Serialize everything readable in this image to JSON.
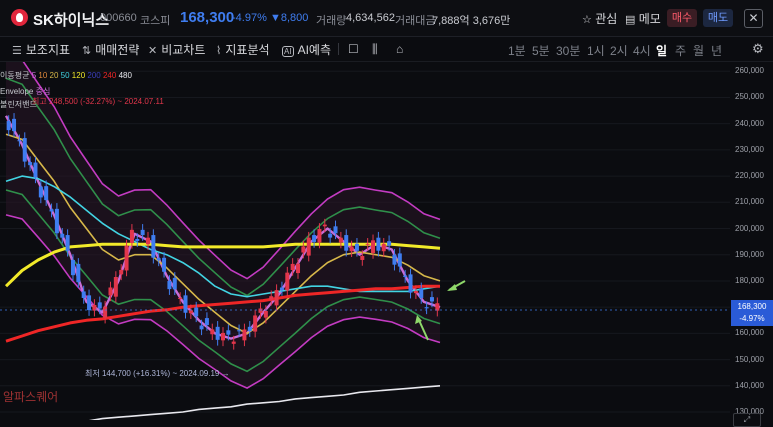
{
  "header": {
    "name": "SK하이닉스",
    "code": "000660",
    "market": "코스피",
    "price": "168,300",
    "change_pct": "-4.97%",
    "change_abs": "▼8,800",
    "volume_label": "거래량",
    "volume": "4,634,562",
    "amount_label": "거래대금",
    "amount": "7,888억 3,676만",
    "interest": "관심",
    "memo": "메모",
    "buy": "매수",
    "sell": "매도"
  },
  "toolbar": {
    "items": [
      "보조지표",
      "매매전략",
      "비교차트",
      "지표분석",
      "AI예측"
    ],
    "periods": [
      "1분",
      "5분",
      "30분",
      "1시",
      "2시",
      "4시",
      "일",
      "주",
      "월",
      "년"
    ],
    "active_period": "일"
  },
  "legend": {
    "ma_title": "이동평균",
    "ma_periods": [
      "5",
      "10",
      "20",
      "50",
      "120",
      "200",
      "240",
      "480"
    ],
    "envelope": "Envelope",
    "envelope_sub": "중심",
    "bollinger": "볼린저밴드",
    "bollinger_sub": "최고 248,500 (-32.27%) ~ 2024.07.11"
  },
  "annotations": {
    "min": "최저 144,700 (+16.31%) ~ 2024.09.19 →"
  },
  "axis": {
    "labels": [
      "260,000",
      "250,000",
      "240,000",
      "230,000",
      "220,000",
      "210,000",
      "200,000",
      "190,000",
      "180,000",
      "170,000",
      "160,000",
      "150,000",
      "140,000",
      "130,000"
    ]
  },
  "current": {
    "price": "168,300",
    "pct": "-4.97%"
  },
  "watermark": "알파스퀘어",
  "colors": {
    "up": "#e2364b",
    "down": "#3f7df0",
    "accent": "#3f7df0"
  },
  "chart_data": {
    "type": "line",
    "title": "",
    "ylim": [
      130000,
      262000
    ],
    "y_ticks": [
      260000,
      250000,
      240000,
      230000,
      220000,
      210000,
      200000,
      190000,
      180000,
      170000,
      160000,
      150000,
      140000,
      130000
    ],
    "series": [
      {
        "name": "5",
        "color": "#c86dd7",
        "values": [
          243000,
          232000,
          218000,
          205000,
          190000,
          172000,
          168000,
          180000,
          198000,
          195000,
          182000,
          172000,
          165000,
          160000,
          158000,
          160000,
          168000,
          175000,
          185000,
          195000,
          200000,
          195000,
          190000,
          194000,
          192000,
          180000,
          172000,
          170000
        ]
      },
      {
        "name": "20",
        "color": "#d7b84a",
        "values": [
          236000,
          234000,
          226000,
          218000,
          208000,
          200000,
          192000,
          188000,
          190000,
          190000,
          185000,
          179000,
          173000,
          168000,
          163000,
          160000,
          164000,
          170000,
          176000,
          182000,
          187000,
          190000,
          191000,
          190000,
          189000,
          186000,
          182000,
          180000
        ]
      },
      {
        "name": "50",
        "color": "#42d4e3",
        "values": [
          218000,
          220000,
          219000,
          216000,
          212000,
          207000,
          202000,
          198000,
          195000,
          192000,
          190000,
          187000,
          183000,
          178000,
          175000,
          174000,
          175000,
          176000,
          177000,
          178000,
          178000,
          177000,
          176000,
          176000,
          176000,
          176000,
          177000,
          178000
        ]
      },
      {
        "name": "120",
        "color": "#f2ea2a",
        "values": [
          178000,
          184000,
          188000,
          191000,
          193000,
          193500,
          194000,
          194000,
          194000,
          194000,
          193500,
          193000,
          193000,
          193000,
          193000,
          193000,
          193000,
          193500,
          194000,
          194000,
          194000,
          194000,
          194000,
          194000,
          194000,
          193500,
          193000,
          192500
        ]
      },
      {
        "name": "240",
        "color": "#ef2626",
        "values": [
          157000,
          159000,
          161000,
          162500,
          164000,
          165000,
          165500,
          166500,
          167500,
          168500,
          169000,
          170000,
          170500,
          171000,
          171500,
          172000,
          172500,
          173500,
          174500,
          175000,
          175500,
          176000,
          176500,
          177000,
          177000,
          177500,
          178000,
          178000
        ]
      },
      {
        "name": "480",
        "color": "#e8e8ee",
        "values": [
          124000,
          124500,
          125000,
          125500,
          126000,
          126500,
          127500,
          128000,
          128500,
          129000,
          129500,
          130000,
          131000,
          131500,
          132000,
          133000,
          133500,
          134000,
          135000,
          135500,
          136000,
          136500,
          137500,
          138000,
          138500,
          139000,
          139500,
          140000
        ]
      }
    ]
  }
}
